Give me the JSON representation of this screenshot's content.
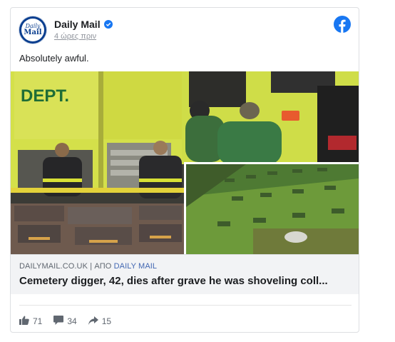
{
  "post": {
    "page_name": "Daily Mail",
    "avatar_top": "Daily",
    "avatar_bottom": "Mail",
    "timestamp": "4 ώρες πριν",
    "text": "Absolutely awful.",
    "fb_icon": "facebook-icon",
    "verified_icon": "verified-badge-icon"
  },
  "link": {
    "domain": "DAILYMAIL.CO.UK",
    "separator": "|",
    "from_label": "ΑΠΟ",
    "publisher": "DAILY MAIL",
    "headline": "Cemetery digger, 42, dies after grave he was shoveling coll..."
  },
  "media": {
    "truck_text": "DEPT."
  },
  "reactions": {
    "likes": "71",
    "comments": "34",
    "shares": "15"
  },
  "colors": {
    "facebook_blue": "#1877f2",
    "daily_mail_blue": "#0a3e8f",
    "truck_yellow": "#d4e04a",
    "grass_green": "#6d9a3a"
  }
}
